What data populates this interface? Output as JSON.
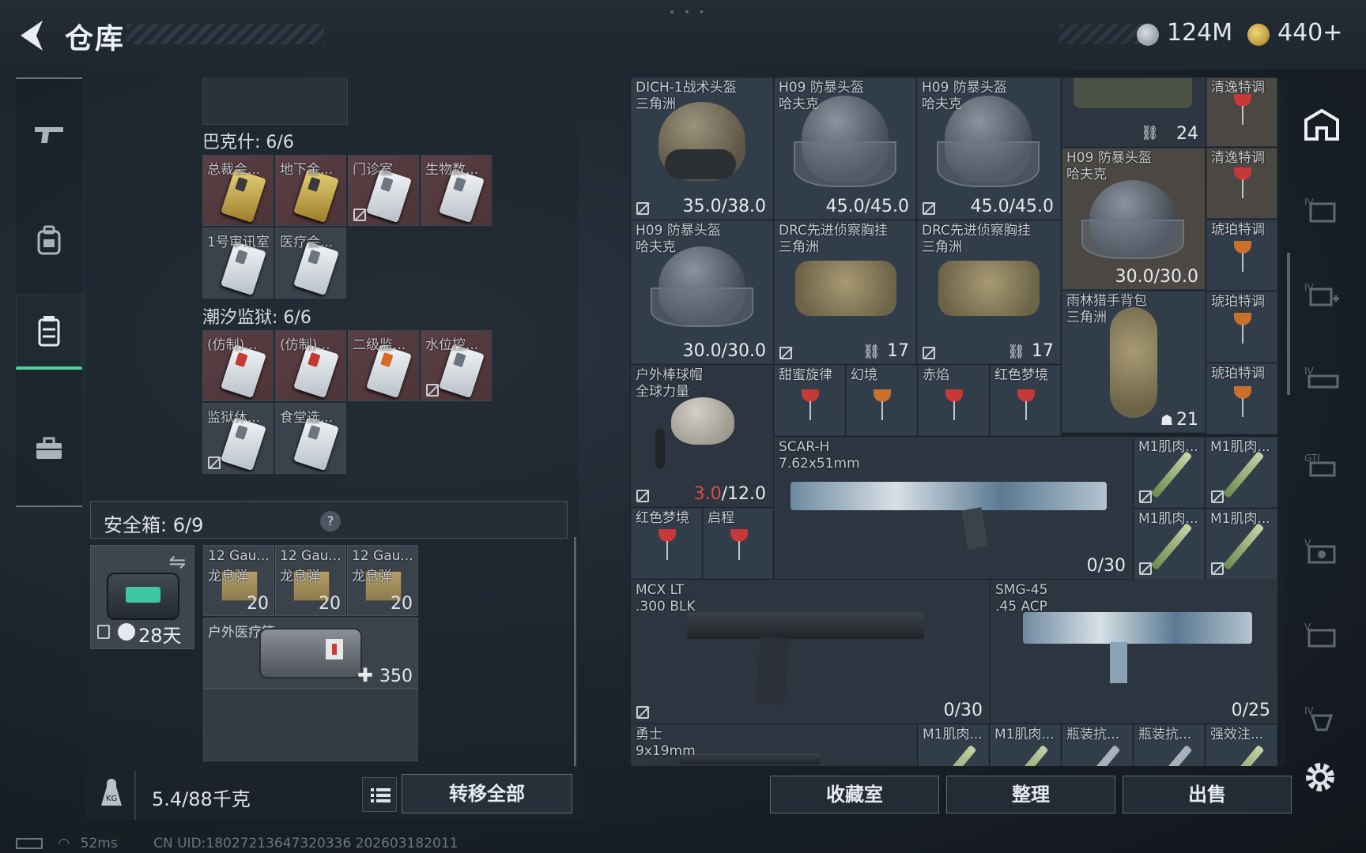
{
  "header": {
    "title": "仓库",
    "currency": [
      {
        "icon": "silver-coin-icon",
        "value": "124M"
      },
      {
        "icon": "gold-coin-icon",
        "value": "440+"
      }
    ]
  },
  "left_nav": [
    {
      "icon": "gun-icon"
    },
    {
      "icon": "backpack-icon"
    },
    {
      "icon": "storage-icon",
      "active": true
    },
    {
      "icon": "briefcase-icon"
    }
  ],
  "sections": [
    {
      "title": "巴克什: 6/6",
      "items": [
        {
          "name": "总裁会...",
          "style": "gold"
        },
        {
          "name": "地下金...",
          "style": "gold"
        },
        {
          "name": "门诊室",
          "style": "white"
        },
        {
          "name": "生物数...",
          "style": "white"
        },
        {
          "name": "1号审讯室",
          "style": "white"
        },
        {
          "name": "医疗会...",
          "style": "white"
        }
      ]
    },
    {
      "title": "潮汐监狱: 6/6",
      "items": [
        {
          "name": "(仿制)...",
          "style": "red"
        },
        {
          "name": "(仿制)...",
          "style": "red"
        },
        {
          "name": "二级监...",
          "style": "orange"
        },
        {
          "name": "水位控...",
          "style": "white"
        },
        {
          "name": "监狱休...",
          "style": "white"
        },
        {
          "name": "食堂选...",
          "style": "white"
        }
      ]
    }
  ],
  "safebox": {
    "label": "安全箱: 6/9",
    "help": "?",
    "days": "28天",
    "items": [
      {
        "name": "12 Gau...",
        "sub": "龙息弹",
        "count": "20"
      },
      {
        "name": "12 Gau...",
        "sub": "龙息弹",
        "count": "20"
      },
      {
        "name": "12 Gau...",
        "sub": "龙息弹",
        "count": "20"
      }
    ],
    "medkit": {
      "name": "户外医疗箱",
      "value": "350"
    }
  },
  "bottom_left": {
    "weight": "5.4/88千克",
    "transfer": "转移全部"
  },
  "items": {
    "helmet1": {
      "name": "DICH-1战术头盔\n三角洲",
      "durability": "35.0/38.0"
    },
    "helmet2": {
      "name": "H09 防暴头盔\n哈夫克",
      "durability": "45.0/45.0"
    },
    "helmet3": {
      "name": "H09 防暴头盔\n哈夫克",
      "durability": "45.0/45.0"
    },
    "top_stack": {
      "count": "24"
    },
    "drink_top": {
      "name": "清逸特调"
    },
    "helmet4": {
      "name": "H09 防暴头盔\n哈夫克",
      "durability": "30.0/30.0"
    },
    "drink2": {
      "name": "清逸特调"
    },
    "helmet5": {
      "name": "H09 防暴头盔\n哈夫克",
      "durability": "30.0/30.0"
    },
    "rig1": {
      "name": "DRC先进侦察胸挂\n三角洲",
      "count": "17"
    },
    "rig2": {
      "name": "DRC先进侦察胸挂\n三角洲",
      "count": "17"
    },
    "drink3": {
      "name": "琥珀特调"
    },
    "backpack": {
      "name": "雨林猎手背包\n三角洲",
      "count": "21"
    },
    "drink4": {
      "name": "琥珀特调"
    },
    "cap": {
      "name": "户外棒球帽\n全球力量",
      "dur_red": "3.0",
      "dur_rest": "/12.0"
    },
    "drink5": {
      "name": "甜蜜旋律"
    },
    "drink6": {
      "name": "幻境"
    },
    "drink7": {
      "name": "赤焰"
    },
    "drink8": {
      "name": "红色梦境"
    },
    "drink9": {
      "name": "琥珀特调"
    },
    "scar": {
      "name": "SCAR-H\n7.62x51mm",
      "ammo": "0/30"
    },
    "m1a": {
      "name": "M1肌肉..."
    },
    "m1b": {
      "name": "M1肌肉..."
    },
    "m1c": {
      "name": "M1肌肉..."
    },
    "m1d": {
      "name": "M1肌肉..."
    },
    "drink10": {
      "name": "红色梦境"
    },
    "drink11": {
      "name": "启程"
    },
    "mcx": {
      "name": "MCX LT\n.300 BLK",
      "ammo": "0/30"
    },
    "smg": {
      "name": "SMG-45\n.45 ACP",
      "ammo": "0/25"
    },
    "warrior": {
      "name": "勇士\n9x19mm"
    },
    "b1": {
      "name": "M1肌肉..."
    },
    "b2": {
      "name": "M1肌肉..."
    },
    "b3": {
      "name": "瓶装抗..."
    },
    "b4": {
      "name": "瓶装抗..."
    },
    "b5": {
      "name": "强效注..."
    }
  },
  "right_nav": [
    {
      "icon": "fortress-icon"
    },
    {
      "icon": "iv-cabinet-icon"
    },
    {
      "icon": "iv-medical-icon"
    },
    {
      "icon": "iv-train-icon"
    },
    {
      "icon": "gti-icon"
    },
    {
      "icon": "v-display-icon"
    },
    {
      "icon": "v-stand-icon"
    },
    {
      "icon": "iv-trophy-icon"
    },
    {
      "icon": "settings-gear-icon"
    }
  ],
  "bottom_buttons": {
    "collection": "收藏室",
    "sort": "整理",
    "sell": "出售"
  },
  "status": {
    "ping": "52ms",
    "uid": "CN UID:18027213647320336 202603182011"
  }
}
